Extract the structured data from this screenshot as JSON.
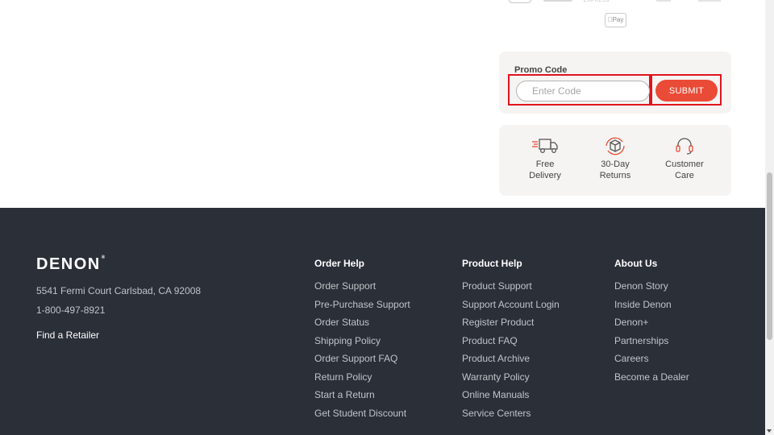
{
  "payments": {
    "amex_text": "EXPRESS",
    "applepay_label": "Pay"
  },
  "promo": {
    "label": "Promo Code",
    "placeholder": "Enter Code",
    "submit_label": "SUBMIT"
  },
  "features": [
    {
      "line1": "Free",
      "line2": "Delivery",
      "icon": "delivery-truck-icon"
    },
    {
      "line1": "30-Day",
      "line2": "Returns",
      "icon": "returns-box-icon"
    },
    {
      "line1": "Customer",
      "line2": "Care",
      "icon": "headset-icon"
    }
  ],
  "colors": {
    "accent": "#ea4b36",
    "highlight": "#e0141e",
    "footer_bg": "#2a2f38"
  },
  "footer": {
    "logo": "DENON",
    "address": "5541 Fermi Court Carlsbad, CA 92008",
    "phone": "1-800-497-8921",
    "retailer": "Find a Retailer",
    "columns": [
      {
        "title": "Order Help",
        "links": [
          "Order Support",
          "Pre-Purchase Support",
          "Order Status",
          "Shipping Policy",
          "Order Support FAQ",
          "Return Policy",
          "Start a Return",
          "Get Student Discount"
        ]
      },
      {
        "title": "Product Help",
        "links": [
          "Product Support",
          "Support Account Login",
          "Register Product",
          "Product FAQ",
          "Product Archive",
          "Warranty Policy",
          "Online Manuals",
          "Service Centers"
        ]
      },
      {
        "title": "About Us",
        "links": [
          "Denon Story",
          "Inside Denon",
          "Denon+",
          "Partnerships",
          "Careers",
          "Become a Dealer"
        ]
      }
    ]
  }
}
